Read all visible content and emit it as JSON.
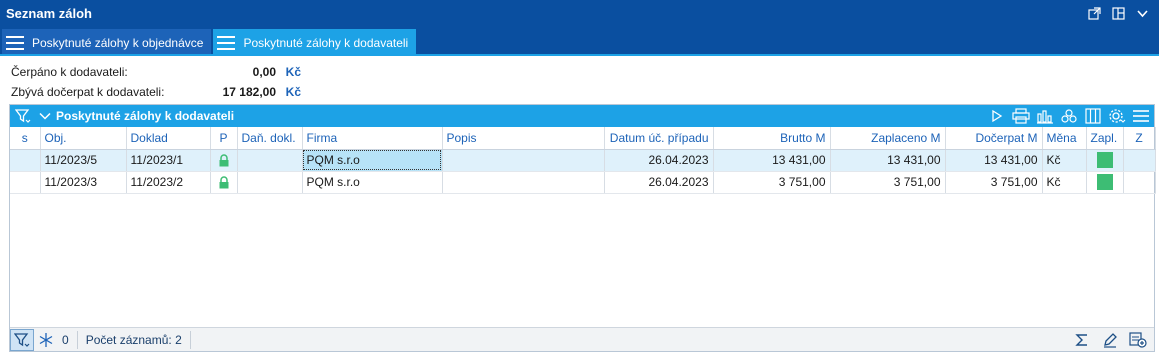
{
  "window": {
    "title": "Seznam záloh"
  },
  "tabs": [
    {
      "label": "Poskytnuté zálohy k objednávce",
      "active": false
    },
    {
      "label": "Poskytnuté zálohy k dodavateli",
      "active": true
    }
  ],
  "summary": {
    "drawn_label": "Čerpáno k dodavateli:",
    "drawn_value": "0,00",
    "drawn_currency": "Kč",
    "remaining_label": "Zbývá dočerpat k dodavateli:",
    "remaining_value": "17 182,00",
    "remaining_currency": "Kč"
  },
  "grid": {
    "title": "Poskytnuté zálohy k dodavateli",
    "columns": [
      "s",
      "Obj.",
      "Doklad",
      "P",
      "Daň. dokl.",
      "Firma",
      "Popis",
      "Datum úč. případu",
      "Brutto M",
      "Zaplaceno M",
      "Dočerpat M",
      "Měna",
      "Zapl.",
      "Z"
    ],
    "rows": [
      {
        "s": "",
        "obj": "11/2023/5",
        "doklad": "11/2023/1",
        "dan": "",
        "firma": "PQM s.r.o",
        "popis": "",
        "datum": "26.04.2023",
        "brutto": "13 431,00",
        "zaplaceno": "13 431,00",
        "docerpat": "13 431,00",
        "mena": "Kč",
        "z": ""
      },
      {
        "s": "",
        "obj": "11/2023/3",
        "doklad": "11/2023/2",
        "dan": "",
        "firma": "PQM s.r.o",
        "popis": "",
        "datum": "26.04.2023",
        "brutto": "3 751,00",
        "zaplaceno": "3 751,00",
        "docerpat": "3 751,00",
        "mena": "Kč",
        "z": ""
      }
    ]
  },
  "statusbar": {
    "count_value": "0",
    "record_count": "Počet záznamů: 2"
  },
  "colors": {
    "titlebar": "#0a4fa0",
    "active_tab": "#1da2e6",
    "header_text": "#1d63b8",
    "paid_green": "#3dbd74"
  }
}
